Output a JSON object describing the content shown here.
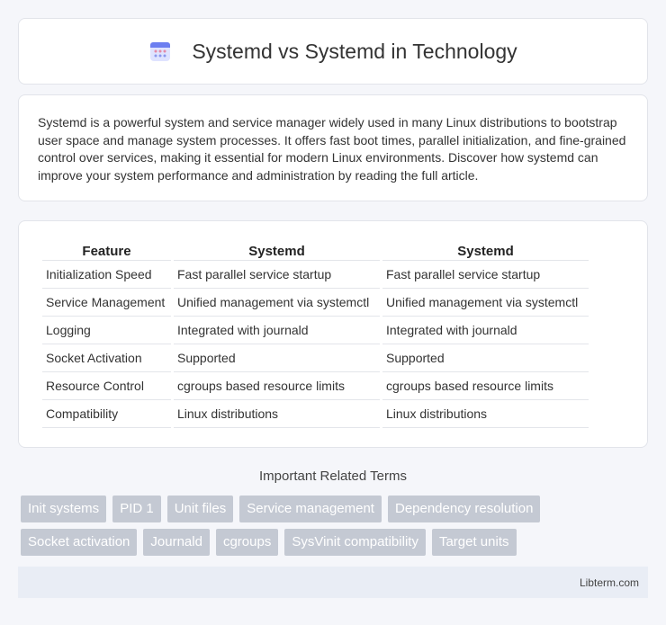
{
  "header": {
    "title": "Systemd vs Systemd in Technology",
    "icon": "calendar-icon"
  },
  "intro": {
    "text": "Systemd is a powerful system and service manager widely used in many Linux distributions to bootstrap user space and manage system processes. It offers fast boot times, parallel initialization, and fine-grained control over services, making it essential for modern Linux environments. Discover how systemd can improve your system performance and administration by reading the full article."
  },
  "table": {
    "headers": [
      "Feature",
      "Systemd",
      "Systemd"
    ],
    "rows": [
      [
        "Initialization Speed",
        "Fast parallel service startup",
        "Fast parallel service startup"
      ],
      [
        "Service Management",
        "Unified management via systemctl",
        "Unified management via systemctl"
      ],
      [
        "Logging",
        "Integrated with journald",
        "Integrated with journald"
      ],
      [
        "Socket Activation",
        "Supported",
        "Supported"
      ],
      [
        "Resource Control",
        "cgroups based resource limits",
        "cgroups based resource limits"
      ],
      [
        "Compatibility",
        "Linux distributions",
        "Linux distributions"
      ]
    ]
  },
  "terms": {
    "title": "Important Related Terms",
    "items": [
      "Init systems",
      "PID 1",
      "Unit files",
      "Service management",
      "Dependency resolution",
      "Socket activation",
      "Journald",
      "cgroups",
      "SysVinit compatibility",
      "Target units"
    ]
  },
  "footer": {
    "site": "Libterm.com"
  }
}
